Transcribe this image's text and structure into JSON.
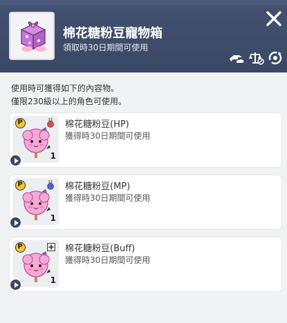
{
  "header": {
    "title": "棉花糖粉豆寵物箱",
    "subtitle": "領取時30日期間可使用",
    "icons": [
      "trade-hand-icon",
      "scale-icon",
      "recycle-icon"
    ],
    "close_icon": "close-icon",
    "colors": {
      "bg": "#3a4866",
      "text": "#ffffff"
    }
  },
  "description": {
    "line1": "使用時可獲得如下的內容物。",
    "line2": "僅限230級以上的角色可使用。"
  },
  "items": [
    {
      "name": "棉花糖粉豆(HP)",
      "sub": "獲得時30日期間可使用",
      "badge": "P",
      "type_icon": "red-potion-icon",
      "qty": "1"
    },
    {
      "name": "棉花糖粉豆(MP)",
      "sub": "獲得時30日期間可使用",
      "badge": "P",
      "type_icon": "blue-potion-icon",
      "qty": "1"
    },
    {
      "name": "棉花糖粉豆(Buff)",
      "sub": "獲得時30日期間可使用",
      "badge": "P",
      "type_icon": "buff-plus-icon",
      "qty": "1"
    }
  ]
}
